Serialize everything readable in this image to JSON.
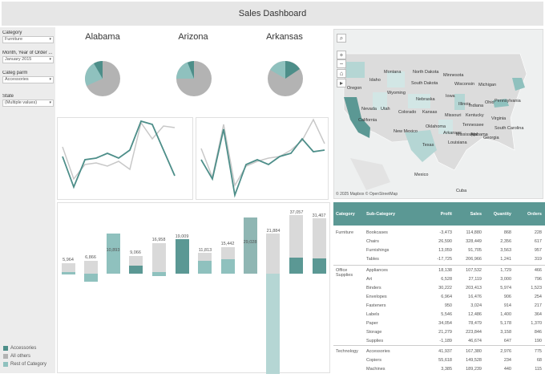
{
  "header": {
    "title": "Sales Dashboard"
  },
  "filters": [
    {
      "label": "Category",
      "value": "Furniture"
    },
    {
      "label": "Month, Year of Order ...",
      "value": "January 2015"
    },
    {
      "label": "Categ parm",
      "value": "Accessories"
    },
    {
      "label": "State",
      "value": "(Multiple values)"
    }
  ],
  "legend": [
    {
      "label": "Accessories",
      "color": "#4d8e89"
    },
    {
      "label": "All others",
      "color": "#b3b3b3"
    },
    {
      "label": "Rest of Category",
      "color": "#8fc1be"
    }
  ],
  "states": [
    "Alabama",
    "Arizona",
    "Arkansas"
  ],
  "map": {
    "credit": "© 2025 Mapbox © OpenStreetMap",
    "labels": [
      "Oregon",
      "Idaho",
      "Montana",
      "North Dakota",
      "Minnesota",
      "Wisconsin",
      "Michigan",
      "South Dakota",
      "Wyoming",
      "Nebraska",
      "Iowa",
      "Illinois",
      "Indiana",
      "Ohio",
      "Pennsylvania",
      "Nevada",
      "Utah",
      "Colorado",
      "Kansas",
      "Missouri",
      "California",
      "New Mexico",
      "Oklahoma",
      "Arkansas",
      "Tennessee",
      "Texas",
      "Louisiana",
      "Mississippi",
      "Alabama",
      "Georgia",
      "South Carolina",
      "Kentucky",
      "Virginia",
      "Mexico",
      "Cuba"
    ]
  },
  "bars": {
    "labels": [
      "5,964",
      "6,866",
      "10,893",
      "9,066",
      "16,958",
      "19,009",
      "11,813",
      "15,442",
      "29,028",
      "21,884",
      "37,057",
      "31,407"
    ]
  },
  "table": {
    "headers": [
      "Category",
      "Sub-Category",
      "Profit",
      "Sales",
      "Quantity",
      "Orders"
    ],
    "rows": [
      {
        "cat": "Furniture",
        "sub": "Bookcases",
        "profit": "-3,473",
        "sales": "114,880",
        "qty": "868",
        "orders": "228"
      },
      {
        "cat": "",
        "sub": "Chairs",
        "profit": "26,590",
        "sales": "328,449",
        "qty": "2,356",
        "orders": "617"
      },
      {
        "cat": "",
        "sub": "Furnishings",
        "profit": "13,059",
        "sales": "91,705",
        "qty": "3,563",
        "orders": "957"
      },
      {
        "cat": "",
        "sub": "Tables",
        "profit": "-17,725",
        "sales": "206,966",
        "qty": "1,241",
        "orders": "319"
      },
      {
        "cat": "Office Supplies",
        "sub": "Appliances",
        "profit": "18,138",
        "sales": "107,532",
        "qty": "1,729",
        "orders": "466"
      },
      {
        "cat": "",
        "sub": "Art",
        "profit": "6,528",
        "sales": "27,119",
        "qty": "3,000",
        "orders": "796"
      },
      {
        "cat": "",
        "sub": "Binders",
        "profit": "30,222",
        "sales": "203,413",
        "qty": "5,974",
        "orders": "1,523"
      },
      {
        "cat": "",
        "sub": "Envelopes",
        "profit": "6,964",
        "sales": "16,476",
        "qty": "906",
        "orders": "254"
      },
      {
        "cat": "",
        "sub": "Fasteners",
        "profit": "950",
        "sales": "3,024",
        "qty": "914",
        "orders": "217"
      },
      {
        "cat": "",
        "sub": "Labels",
        "profit": "5,546",
        "sales": "12,486",
        "qty": "1,400",
        "orders": "364"
      },
      {
        "cat": "",
        "sub": "Paper",
        "profit": "34,054",
        "sales": "78,479",
        "qty": "5,178",
        "orders": "1,370"
      },
      {
        "cat": "",
        "sub": "Storage",
        "profit": "21,279",
        "sales": "223,844",
        "qty": "3,158",
        "orders": "846"
      },
      {
        "cat": "",
        "sub": "Supplies",
        "profit": "-1,189",
        "sales": "46,674",
        "qty": "647",
        "orders": "190"
      },
      {
        "cat": "Technology",
        "sub": "Accessories",
        "profit": "41,937",
        "sales": "167,380",
        "qty": "2,976",
        "orders": "775"
      },
      {
        "cat": "",
        "sub": "Copiers",
        "profit": "55,618",
        "sales": "149,528",
        "qty": "234",
        "orders": "68"
      },
      {
        "cat": "",
        "sub": "Machines",
        "profit": "3,385",
        "sales": "189,239",
        "qty": "440",
        "orders": "115"
      }
    ]
  }
}
